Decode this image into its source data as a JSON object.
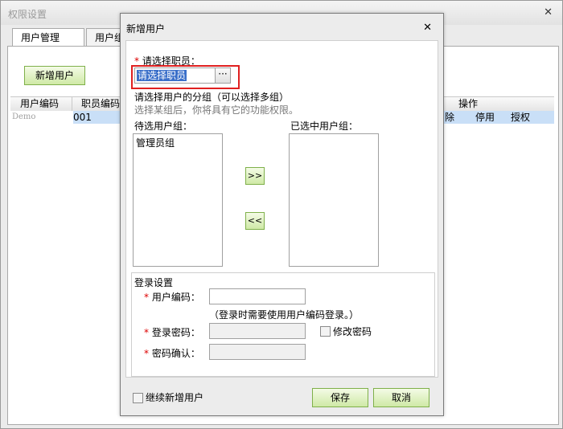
{
  "outer": {
    "title": "权限设置",
    "close_glyph": "✕",
    "tabs": [
      "用户管理",
      "用户组"
    ],
    "add_user_button": "新增用户",
    "grid": {
      "columns": [
        "用户编码",
        "职员编码",
        "操作"
      ],
      "row": {
        "user_code": "Demo",
        "employee_code": "001",
        "actions": [
          "除",
          "停用",
          "授权"
        ]
      }
    }
  },
  "dialog": {
    "title": "新增用户",
    "close_glyph": "✕",
    "employee_label": "请选择职员：",
    "employee_value": "请选择职员",
    "browse_glyph": "···",
    "group_heading": "请选择用户的分组（可以选择多组）",
    "group_hint": "选择某组后，你将具有它的功能权限。",
    "available_label": "待选用户组：",
    "selected_label": "已选中用户组：",
    "available_items": [
      "管理员组"
    ],
    "selected_items": [],
    "move_right": ">>",
    "move_left": "<<",
    "login_section": "登录设置",
    "user_code_label": "用户编码：",
    "user_code_value": "",
    "login_hint": "（登录时需要使用用户编码登录。）",
    "password_label": "登录密码：",
    "modify_password_label": "修改密码",
    "confirm_label": "密码确认：",
    "continue_label": "继续新增用户",
    "save_button": "保存",
    "cancel_button": "取消",
    "required_mark": "*"
  }
}
